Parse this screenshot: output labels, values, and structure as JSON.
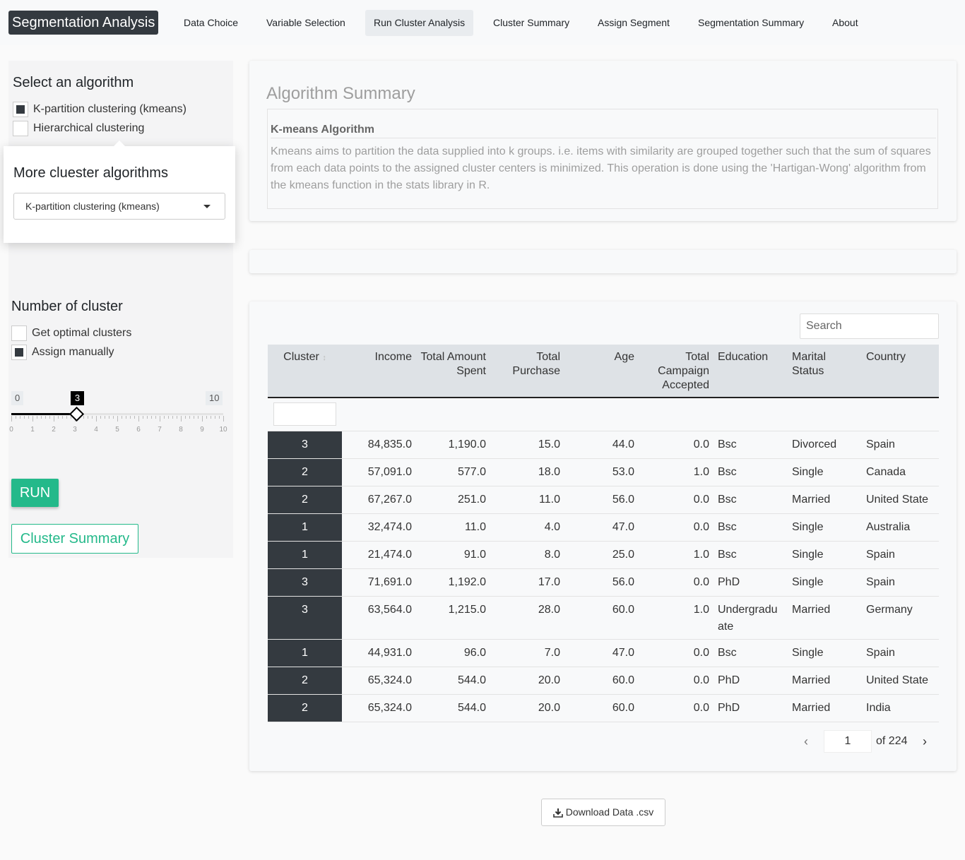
{
  "app": {
    "brand": "Segmentation Analysis"
  },
  "nav": {
    "items": [
      {
        "label": "Data Choice"
      },
      {
        "label": "Variable Selection"
      },
      {
        "label": "Run Cluster Analysis"
      },
      {
        "label": "Cluster Summary"
      },
      {
        "label": "Assign Segment"
      },
      {
        "label": "Segmentation Summary"
      },
      {
        "label": "About"
      }
    ],
    "active": "Run Cluster Analysis"
  },
  "sidebar": {
    "algorithm_title": "Select an algorithm",
    "algorithms": [
      {
        "label": "K-partition clustering (kmeans)",
        "checked": true
      },
      {
        "label": "Hierarchical clustering",
        "checked": false
      }
    ],
    "popover": {
      "title": "More cluester algorithms",
      "select_value": "K-partition clustering (kmeans)"
    },
    "cluster_title": "Number of cluster",
    "cluster_options": [
      {
        "label": "Get optimal clusters",
        "checked": false
      },
      {
        "label": "Assign manually",
        "checked": true
      }
    ],
    "slider": {
      "min": "0",
      "max": "10",
      "value": "3",
      "ticks": [
        "0",
        "1",
        "2",
        "3",
        "4",
        "5",
        "6",
        "7",
        "8",
        "9",
        "10"
      ]
    },
    "run_label": "RUN",
    "summary_label": "Cluster Summary"
  },
  "summary": {
    "title": "Algorithm Summary",
    "algorithm_name": "K-means Algorithm",
    "description": "Kmeans aims to partition the data supplied into k groups. i.e. items with similarity are grouped together such that the sum of squares from each data points to the assigned cluster centers is minimized. This operation is done using the 'Hartigan-Wong' algorithm from the kmeans function in the stats library in R."
  },
  "table": {
    "search_placeholder": "Search",
    "columns": [
      "Cluster",
      "Income",
      "Total Amount Spent",
      "Total Purchase",
      "Age",
      "Total Campaign Accepted",
      "Education",
      "Marital Status",
      "Country"
    ],
    "rows": [
      [
        "3",
        "84,835.0",
        "1,190.0",
        "15.0",
        "44.0",
        "0.0",
        "Bsc",
        "Divorced",
        "Spain"
      ],
      [
        "2",
        "57,091.0",
        "577.0",
        "18.0",
        "53.0",
        "1.0",
        "Bsc",
        "Single",
        "Canada"
      ],
      [
        "2",
        "67,267.0",
        "251.0",
        "11.0",
        "56.0",
        "0.0",
        "Bsc",
        "Married",
        "United State"
      ],
      [
        "1",
        "32,474.0",
        "11.0",
        "4.0",
        "47.0",
        "0.0",
        "Bsc",
        "Single",
        "Australia"
      ],
      [
        "1",
        "21,474.0",
        "91.0",
        "8.0",
        "25.0",
        "1.0",
        "Bsc",
        "Single",
        "Spain"
      ],
      [
        "3",
        "71,691.0",
        "1,192.0",
        "17.0",
        "56.0",
        "0.0",
        "PhD",
        "Single",
        "Spain"
      ],
      [
        "3",
        "63,564.0",
        "1,215.0",
        "28.0",
        "60.0",
        "1.0",
        "Undergraduate",
        "Married",
        "Germany"
      ],
      [
        "1",
        "44,931.0",
        "96.0",
        "7.0",
        "47.0",
        "0.0",
        "Bsc",
        "Single",
        "Spain"
      ],
      [
        "2",
        "65,324.0",
        "544.0",
        "20.0",
        "60.0",
        "0.0",
        "PhD",
        "Married",
        "United State"
      ],
      [
        "2",
        "65,324.0",
        "544.0",
        "20.0",
        "60.0",
        "0.0",
        "PhD",
        "Married",
        "India"
      ]
    ],
    "pager": {
      "page": "1",
      "of_label": "of 224"
    }
  },
  "download_label": "Download Data .csv",
  "colors": {
    "accent": "#24b98a",
    "dark": "#343a40"
  },
  "icons": [
    "chevron-left-icon",
    "chevron-right-icon",
    "download-icon",
    "dropdown-caret-icon",
    "sort-icon"
  ]
}
